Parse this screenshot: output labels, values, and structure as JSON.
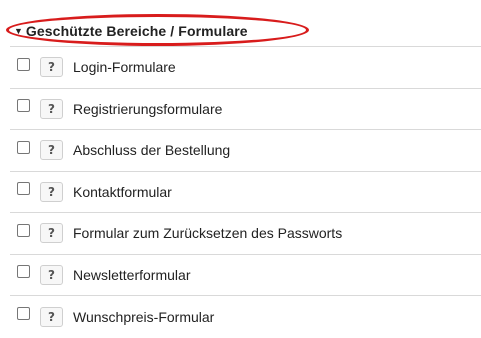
{
  "section": {
    "title": "Geschützte Bereiche / Formulare",
    "expanded": true,
    "caret_icon": "caret-down-icon",
    "highlight_color": "#d81c1c",
    "help_symbol": "?",
    "items": [
      {
        "label": "Login-Formulare",
        "checked": false
      },
      {
        "label": "Registrierungsformulare",
        "checked": false
      },
      {
        "label": "Abschluss der Bestellung",
        "checked": false
      },
      {
        "label": "Kontaktformular",
        "checked": false
      },
      {
        "label": "Formular zum Zurücksetzen des Passworts",
        "checked": false
      },
      {
        "label": "Newsletterformular",
        "checked": false
      },
      {
        "label": "Wunschpreis-Formular",
        "checked": false
      }
    ]
  }
}
